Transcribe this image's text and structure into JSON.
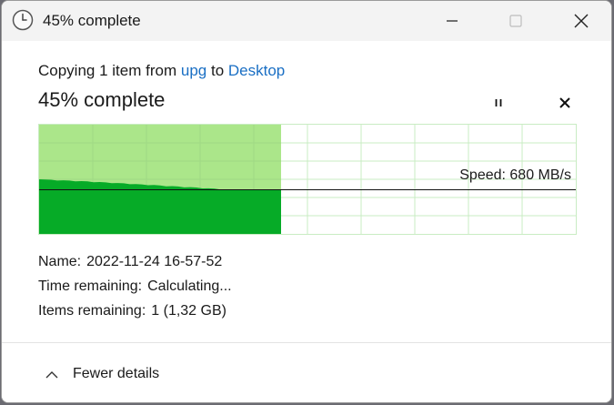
{
  "window": {
    "title": "45% complete",
    "title_icon": "clock-icon",
    "controls": {
      "minimize": "minimize-icon",
      "maximize": "maximize-icon",
      "close": "close-icon"
    }
  },
  "header": {
    "prefix": "Copying 1 item from",
    "source": "upg",
    "connector": "to",
    "destination": "Desktop",
    "progress_title": "45% complete"
  },
  "actions": {
    "pause": "pause-icon",
    "cancel": "cancel-icon"
  },
  "transfer": {
    "percent": 45,
    "speed_label": "Speed: 680 MB/s",
    "name_label": "Name:",
    "name_value": "2022-11-24 16-57-52",
    "time_label": "Time remaining:",
    "time_value": "Calculating...",
    "items_label": "Items remaining:",
    "items_value": "1 (1,32 GB)"
  },
  "footer": {
    "toggle_label": "Fewer details",
    "toggle_icon": "chevron-up-icon"
  },
  "colors": {
    "progress_fill": "#abe68a",
    "speed_fill": "#06ab27",
    "grid": "#c9ecc3",
    "link": "#1a6fc4"
  }
}
